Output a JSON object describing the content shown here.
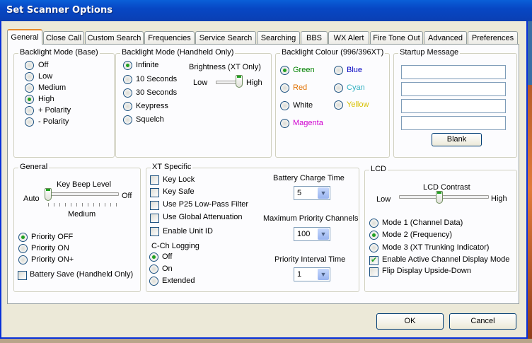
{
  "window": {
    "title": "Set Scanner Options"
  },
  "tabs": [
    {
      "label": "General",
      "active": true
    },
    {
      "label": "Close Call"
    },
    {
      "label": "Custom Search"
    },
    {
      "label": "Frequencies"
    },
    {
      "label": "Service Search"
    },
    {
      "label": "Searching"
    },
    {
      "label": "BBS"
    },
    {
      "label": "WX Alert"
    },
    {
      "label": "Fire Tone Out"
    },
    {
      "label": "Advanced"
    },
    {
      "label": "Preferences"
    }
  ],
  "backlight_base": {
    "title": "Backlight Mode (Base)",
    "options": [
      "Off",
      "Low",
      "Medium",
      "High",
      "+ Polarity",
      "- Polarity"
    ],
    "selected": "High"
  },
  "backlight_handheld": {
    "title": "Backlight Mode (Handheld Only)",
    "options": [
      "Infinite",
      "10 Seconds",
      "30 Seconds",
      "Keypress",
      "Squelch"
    ],
    "selected": "Infinite",
    "brightness_label": "Brightness (XT Only)",
    "low_label": "Low",
    "high_label": "High",
    "brightness_level": 1.0
  },
  "backlight_colour": {
    "title": "Backlight Colour (996/396XT)",
    "options": [
      {
        "label": "Green",
        "color": "#008000"
      },
      {
        "label": "Blue",
        "color": "#0000c0"
      },
      {
        "label": "Red",
        "color": "#e07000"
      },
      {
        "label": "Cyan",
        "color": "#30b0c0"
      },
      {
        "label": "White",
        "color": "#000000"
      },
      {
        "label": "Yellow",
        "color": "#d8c000"
      },
      {
        "label": "Magenta",
        "color": "#d000d0"
      }
    ],
    "selected": "Green"
  },
  "startup_message": {
    "title": "Startup Message",
    "lines": [
      "",
      "",
      "",
      ""
    ],
    "blank_button": "Blank"
  },
  "general": {
    "title": "General",
    "key_beep_label": "Key Beep Level",
    "auto_label": "Auto",
    "off_label": "Off",
    "medium_label": "Medium",
    "key_beep_level": 0.0,
    "priority_options": [
      "Priority OFF",
      "Priority ON",
      "Priority ON+"
    ],
    "priority_selected": "Priority OFF",
    "battery_save_label": "Battery Save (Handheld Only)",
    "battery_save_checked": false
  },
  "xt_specific": {
    "title": "XT Specific",
    "checks": [
      {
        "label": "Key Lock",
        "checked": false
      },
      {
        "label": "Key Safe",
        "checked": false
      },
      {
        "label": "Use P25 Low-Pass Filter",
        "checked": false
      },
      {
        "label": "Use Global Attenuation",
        "checked": false
      },
      {
        "label": "Enable Unit ID",
        "checked": false
      }
    ],
    "cch_logging_label": "C-Ch Logging",
    "cch_options": [
      "Off",
      "On",
      "Extended"
    ],
    "cch_selected": "Off",
    "battery_charge_label": "Battery Charge Time",
    "battery_charge_value": "5",
    "max_priority_label": "Maximum Priority Channels",
    "max_priority_value": "100",
    "priority_interval_label": "Priority Interval Time",
    "priority_interval_value": "1"
  },
  "lcd": {
    "title": "LCD",
    "contrast_label": "LCD Contrast",
    "low_label": "Low",
    "high_label": "High",
    "contrast_level": 0.45,
    "modes": [
      "Mode 1 (Channel Data)",
      "Mode 2 (Frequency)",
      "Mode 3 (XT Trunking Indicator)"
    ],
    "mode_selected": "Mode 2 (Frequency)",
    "checks": [
      {
        "label": "Enable Active Channel Display Mode",
        "checked": true
      },
      {
        "label": "Flip Display Upside-Down",
        "checked": false
      }
    ]
  },
  "buttons": {
    "ok": "OK",
    "cancel": "Cancel"
  }
}
